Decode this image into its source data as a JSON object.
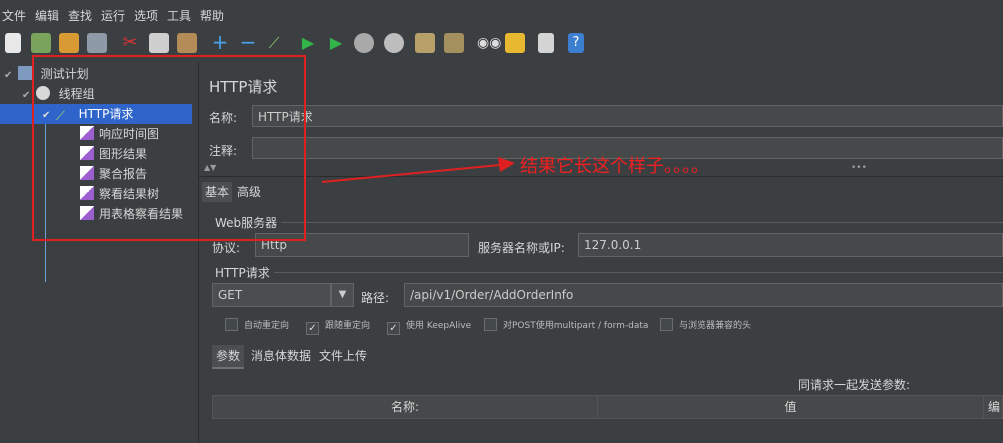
{
  "menu": [
    "文件",
    "编辑",
    "查找",
    "运行",
    "选项",
    "工具",
    "帮助"
  ],
  "toolbar_icons": [
    "new-icon",
    "templates-icon",
    "open-icon",
    "save-icon",
    "cut-icon",
    "copy-icon",
    "paste-icon",
    "expand-icon",
    "collapse-icon",
    "toggle-icon",
    "start-icon",
    "start-no-pause-icon",
    "stop-icon",
    "shutdown-icon",
    "clear-icon",
    "clear-all-icon",
    "search-icon",
    "reset-search-icon",
    "function-helper-icon",
    "help-icon"
  ],
  "tree": {
    "root": "测试计划",
    "thread_group": "线程组",
    "selected": "HTTP请求",
    "children": [
      "响应时间图",
      "图形结果",
      "聚合报告",
      "察看结果树",
      "用表格察看结果"
    ]
  },
  "panel": {
    "title": "HTTP请求",
    "name_label": "名称:",
    "name_value": "HTTP请求",
    "comment_label": "注释:",
    "comment_value": "",
    "tab_basic": "基本",
    "tab_advanced": "高级",
    "web_server_label": "Web服务器",
    "protocol_label": "协议:",
    "protocol_value": "Http",
    "server_label": "服务器名称或IP:",
    "server_value": "127.0.0.1",
    "http_request_label": "HTTP请求",
    "method_value": "GET",
    "path_label": "路径:",
    "path_value": "/api/v1/Order/AddOrderInfo",
    "checkboxes": [
      {
        "label": "自动重定向",
        "checked": false
      },
      {
        "label": "跟随重定向",
        "checked": true
      },
      {
        "label": "使用 KeepAlive",
        "checked": true
      },
      {
        "label": "对POST使用multipart / form-data",
        "checked": false
      },
      {
        "label": "与浏览器兼容的头",
        "checked": false
      }
    ],
    "sub_tabs": [
      "参数",
      "消息体数据",
      "文件上传"
    ],
    "send_params_label": "同请求一起发送参数:",
    "columns": [
      "名称:",
      "值",
      "编"
    ]
  },
  "annotation": {
    "text": "结果它长这个样子。。。。",
    "color": "#f02020"
  },
  "colors": {
    "background": "#3c3f41",
    "selection": "#2f65ca",
    "annotation": "#e02020"
  }
}
